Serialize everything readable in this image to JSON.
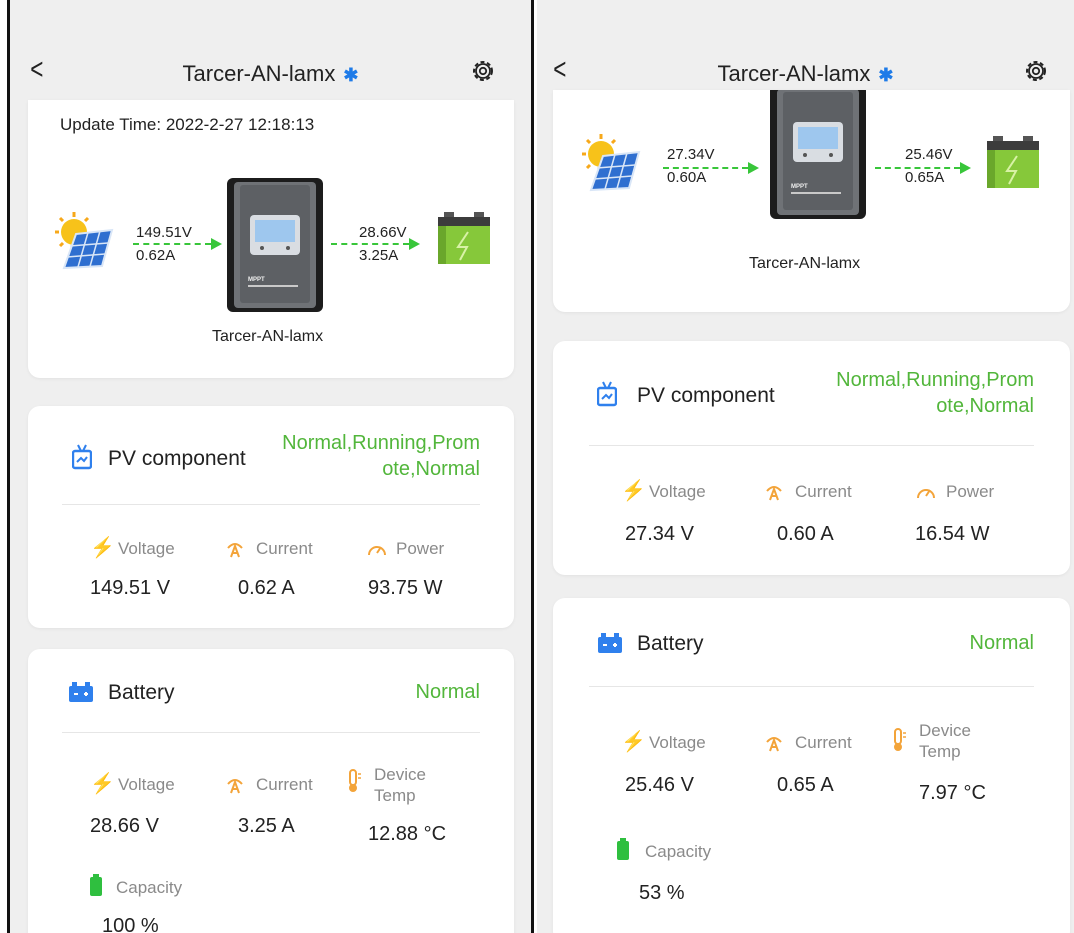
{
  "left": {
    "title": "Tarcer-AN-lamx",
    "update_time": "Update Time: 2022-2-27 12:18:13",
    "flow": {
      "pv_voltage": "149.51V",
      "pv_current": "0.62A",
      "bat_voltage": "28.66V",
      "bat_current": "3.25A",
      "device_name": "Tarcer-AN-lamx"
    },
    "pv": {
      "title": "PV component",
      "status_line1": "Normal,Running,Prom",
      "status_line2": "ote,Normal",
      "voltage_label": "Voltage",
      "current_label": "Current",
      "power_label": "Power",
      "voltage": "149.51 V",
      "current": "0.62 A",
      "power": "93.75 W"
    },
    "battery": {
      "title": "Battery",
      "status": "Normal",
      "voltage_label": "Voltage",
      "current_label": "Current",
      "temp_label_1": "Device",
      "temp_label_2": "Temp",
      "voltage": "28.66 V",
      "current": "3.25 A",
      "temp": "12.88 °C",
      "capacity_label": "Capacity",
      "capacity": "100 %"
    }
  },
  "right": {
    "title": "Tarcer-AN-lamx",
    "flow": {
      "pv_voltage": "27.34V",
      "pv_current": "0.60A",
      "bat_voltage": "25.46V",
      "bat_current": "0.65A",
      "device_name": "Tarcer-AN-lamx"
    },
    "pv": {
      "title": "PV component",
      "status_line1": "Normal,Running,Prom",
      "status_line2": "ote,Normal",
      "voltage_label": "Voltage",
      "current_label": "Current",
      "power_label": "Power",
      "voltage": "27.34 V",
      "current": "0.60 A",
      "power": "16.54 W"
    },
    "battery": {
      "title": "Battery",
      "status": "Normal",
      "voltage_label": "Voltage",
      "current_label": "Current",
      "temp_label_1": "Device",
      "temp_label_2": "Temp",
      "voltage": "25.46 V",
      "current": "0.65 A",
      "temp": "7.97 °C",
      "capacity_label": "Capacity",
      "capacity": "53 %"
    }
  },
  "icons": {
    "back": "chevron-left-icon",
    "bluetooth": "bluetooth-icon",
    "settings": "gear-icon",
    "solar": "solar-panel-icon",
    "battery": "battery-icon",
    "controller": "mppt-controller-icon",
    "voltage": "lightning-icon",
    "current": "current-icon",
    "power": "gauge-icon",
    "temp": "thermometer-icon",
    "capacity": "battery-level-icon"
  },
  "colors": {
    "status_green": "#52b63b",
    "accent_orange": "#f3a43a",
    "bluetooth_blue": "#1e7be8",
    "flow_green": "#38c63a"
  }
}
